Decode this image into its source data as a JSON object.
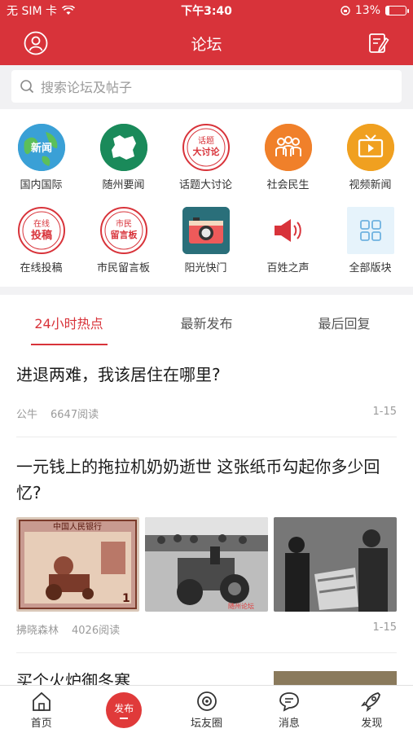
{
  "status_bar": {
    "carrier": "无 SIM 卡",
    "time": "下午3:40",
    "battery": "13%"
  },
  "header": {
    "title": "论坛"
  },
  "search": {
    "placeholder": "搜索论坛及帖子"
  },
  "categories": [
    {
      "label": "国内国际",
      "icon_text": "新闻",
      "icon": "globe-icon",
      "color": "#3aa0d6"
    },
    {
      "label": "随州要闻",
      "icon_text": "",
      "icon": "map-icon",
      "color": "#1a8a5a"
    },
    {
      "label": "话题大讨论",
      "icon_text": "话题大讨论",
      "icon": "seal-icon",
      "color": "#d8333a"
    },
    {
      "label": "社会民生",
      "icon_text": "",
      "icon": "people-icon",
      "color": "#f0802a"
    },
    {
      "label": "视频新闻",
      "icon_text": "",
      "icon": "tv-icon",
      "color": "#f0a020"
    },
    {
      "label": "在线投稿",
      "icon_text": "在线投稿",
      "icon": "seal-icon",
      "color": "#d8333a"
    },
    {
      "label": "市民留言板",
      "icon_text": "市民留言板",
      "icon": "seal-icon",
      "color": "#d8333a"
    },
    {
      "label": "阳光快门",
      "icon_text": "",
      "icon": "camera-icon",
      "color": "#2a6f7a"
    },
    {
      "label": "百姓之声",
      "icon_text": "",
      "icon": "megaphone-icon",
      "color": "#d8333a"
    },
    {
      "label": "全部版块",
      "icon_text": "",
      "icon": "grid-icon",
      "color": "#6fb2e0"
    }
  ],
  "tabs": [
    {
      "label": "24小时热点",
      "active": true
    },
    {
      "label": "最新发布",
      "active": false
    },
    {
      "label": "最后回复",
      "active": false
    }
  ],
  "posts": [
    {
      "title": "进退两难，我该居住在哪里?",
      "author": "公牛",
      "reads": "6647阅读",
      "date": "1-15"
    },
    {
      "title": "一元钱上的拖拉机奶奶逝世 这张纸币勾起你多少回忆?",
      "author": "拂晓森林",
      "reads": "4026阅读",
      "date": "1-15",
      "image_banknote": "中国人民银行",
      "image_watermark": "随州论坛"
    },
    {
      "title": "买个火炉御冬寒"
    }
  ],
  "tabbar": [
    {
      "label": "首页",
      "icon": "home-icon"
    },
    {
      "label": "",
      "icon": "publish-icon",
      "badge": "发布"
    },
    {
      "label": "坛友圈",
      "icon": "eye-icon"
    },
    {
      "label": "消息",
      "icon": "message-icon"
    },
    {
      "label": "发现",
      "icon": "rocket-icon"
    }
  ],
  "colors": {
    "brand": "#d8333a",
    "text": "#222222",
    "muted": "#9b9b9b"
  }
}
